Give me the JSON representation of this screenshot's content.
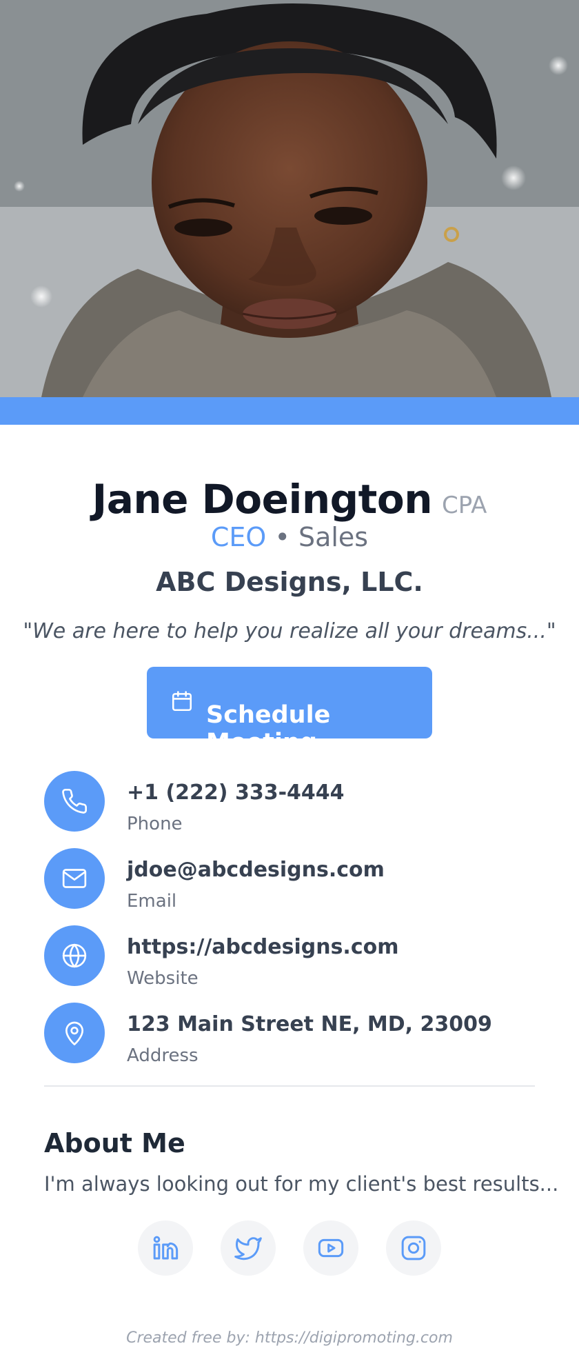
{
  "profile": {
    "name": "Jane Doeington",
    "credential": "CPA",
    "role": "CEO",
    "separator": "•",
    "department": "Sales",
    "company": "ABC Designs, LLC.",
    "tagline": "\"We are here to help you realize all your dreams...\""
  },
  "cta": {
    "label": "Schedule Meeting",
    "icon": "calendar-icon"
  },
  "contacts": [
    {
      "value": "+1 (222) 333-4444",
      "label": "Phone",
      "icon": "phone-icon"
    },
    {
      "value": "jdoe@abcdesigns.com",
      "label": "Email",
      "icon": "mail-icon"
    },
    {
      "value": "https://abcdesigns.com",
      "label": "Website",
      "icon": "globe-icon"
    },
    {
      "value": "123 Main Street NE, MD, 23009",
      "label": "Address",
      "icon": "map-pin-icon"
    }
  ],
  "about": {
    "heading": "About Me",
    "text": "I'm always looking out for my client's best results..."
  },
  "social": [
    {
      "icon": "linkedin-icon"
    },
    {
      "icon": "twitter-icon"
    },
    {
      "icon": "youtube-icon"
    },
    {
      "icon": "instagram-icon"
    }
  ],
  "footer": {
    "text": "Created free by: https://digipromoting.com"
  },
  "colors": {
    "accent": "#5b9bf8",
    "heading": "#111827",
    "muted": "#6b7280"
  }
}
